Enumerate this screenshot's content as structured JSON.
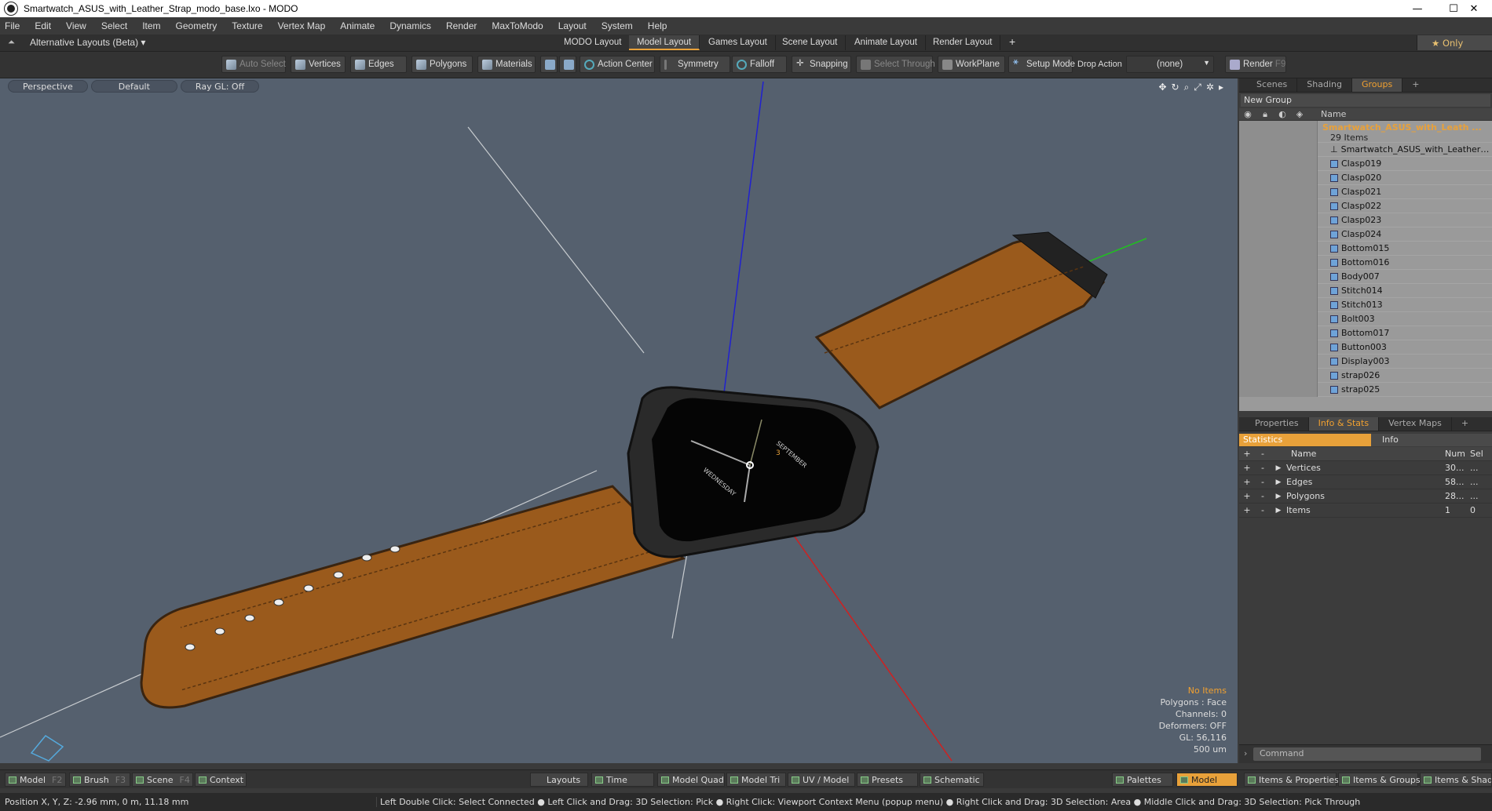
{
  "window": {
    "title": "Smartwatch_ASUS_with_Leather_Strap_modo_base.lxo - MODO",
    "minimize": "—",
    "maximize": "☐",
    "close": "✕"
  },
  "menu": [
    "File",
    "Edit",
    "View",
    "Select",
    "Item",
    "Geometry",
    "Texture",
    "Vertex Map",
    "Animate",
    "Dynamics",
    "Render",
    "MaxToModo",
    "Layout",
    "System",
    "Help"
  ],
  "layouts": {
    "alternative": "Alternative Layouts (Beta) ▾",
    "tabs": [
      "MODO Layout",
      "Model Layout",
      "Games Layout",
      "Scene Layout",
      "Animate Layout",
      "Render Layout"
    ],
    "active": "Model Layout",
    "add": "+",
    "only": "★ Only"
  },
  "toolbar": {
    "auto_select": "Auto Select",
    "vertices": "Vertices",
    "edges": "Edges",
    "polygons": "Polygons",
    "materials": "Materials",
    "action_center": "Action Center",
    "symmetry": "Symmetry",
    "falloff": "Falloff",
    "snapping": "Snapping",
    "select_through": "Select Through",
    "workplane": "WorkPlane",
    "setup_mode": "Setup Mode",
    "drop_action": "Drop Action",
    "drop_value": "(none)",
    "render": "Render",
    "render_key": "F9"
  },
  "viewport": {
    "view": "Perspective",
    "shading": "Default",
    "raygl": "Ray GL: Off",
    "watch_text_1": "WEDNESDAY",
    "watch_text_2": "SEPTEMBER",
    "watch_date": "3",
    "stats": {
      "no_items": "No Items",
      "polygons": "Polygons : Face",
      "channels": "Channels: 0",
      "deformers": "Deformers: OFF",
      "gl": "GL: 56,116",
      "scale": "500 um"
    }
  },
  "groups_panel": {
    "tabs": [
      "Scenes",
      "Shading",
      "Groups"
    ],
    "active": "Groups",
    "new_group": "New Group",
    "col_name": "Name",
    "root": {
      "name": "Smartwatch_ASUS_with_Leath ...",
      "count": "29 Items"
    },
    "items": [
      "Smartwatch_ASUS_with_Leather_S...",
      "Clasp019",
      "Clasp020",
      "Clasp021",
      "Clasp022",
      "Clasp023",
      "Clasp024",
      "Bottom015",
      "Bottom016",
      "Body007",
      "Stitch014",
      "Stitch013",
      "Bolt003",
      "Bottom017",
      "Button003",
      "Display003",
      "strap026",
      "strap025"
    ]
  },
  "info_panel": {
    "tabs": [
      "Properties",
      "Info & Stats",
      "Vertex Maps"
    ],
    "active": "Info & Stats",
    "statistics": "Statistics",
    "info": "Info",
    "cols": {
      "name": "Name",
      "num": "Num",
      "sel": "Sel"
    },
    "rows": [
      {
        "name": "Vertices",
        "num": "30...",
        "sel": "..."
      },
      {
        "name": "Edges",
        "num": "58...",
        "sel": "..."
      },
      {
        "name": "Polygons",
        "num": "28...",
        "sel": "..."
      },
      {
        "name": "Items",
        "num": "1",
        "sel": "0"
      }
    ]
  },
  "command": {
    "placeholder": "Command"
  },
  "bottombar": {
    "model": "Model",
    "model_key": "F2",
    "brush": "Brush",
    "brush_key": "F3",
    "scene": "Scene",
    "scene_key": "F4",
    "context": "Context",
    "layouts": "Layouts",
    "time": "Time",
    "model_quad": "Model Quad",
    "model_tri": "Model Tri",
    "uv_model": "UV / Model",
    "presets": "Presets",
    "schematic": "Schematic",
    "palettes": "Palettes",
    "model_active": "Model",
    "items_properties": "Items & Properties",
    "items_groups": "Items & Groups",
    "items_shading": "Items & Shadin"
  },
  "status": {
    "position": "Position X, Y, Z:   -2.96 mm, 0 m, 11.18 mm",
    "hint": "Left Double Click: Select Connected ● Left Click and Drag: 3D Selection: Pick ● Right Click: Viewport Context Menu (popup menu) ● Right Click and Drag: 3D Selection: Area ● Middle Click and Drag: 3D Selection: Pick Through"
  },
  "colors": {
    "accent": "#e8a13a",
    "viewport_bg": "#55606e",
    "strap": "#9a5a1c",
    "axis_x": "#d02020",
    "axis_y": "#20c020",
    "axis_z": "#2020d0"
  }
}
